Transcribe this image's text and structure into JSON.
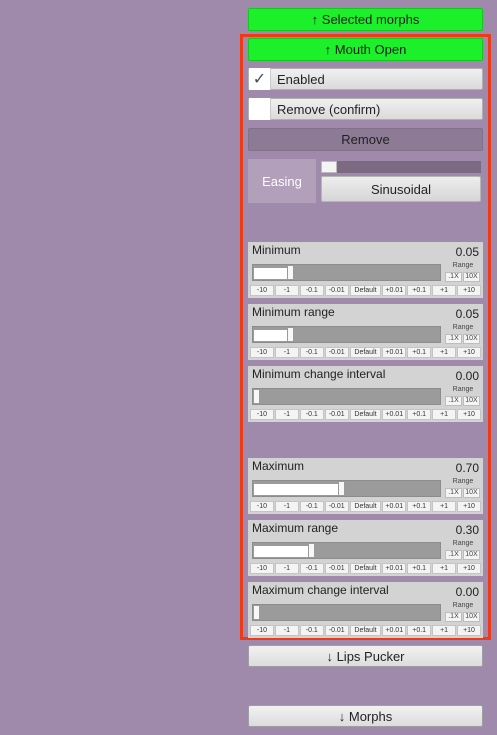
{
  "buttons": {
    "selected_morphs": "↑ Selected morphs",
    "mouth_open": "↑ Mouth Open",
    "remove": "Remove",
    "lips_pucker": "↓ Lips Pucker",
    "morphs": "↓ Morphs"
  },
  "toggles": {
    "enabled": {
      "label": "Enabled",
      "checked": true,
      "check": "✓"
    },
    "remove_confirm": {
      "label": "Remove (confirm)",
      "checked": false
    }
  },
  "easing": {
    "label": "Easing",
    "value": "Sinusoidal",
    "level": 0.0
  },
  "step_labels": [
    "-10",
    "-1",
    "-0.1",
    "-0.01",
    "Default",
    "+0.01",
    "+0.1",
    "+1",
    "+10"
  ],
  "range": {
    "label": "Range",
    "down": ".1X",
    "up": "10X"
  },
  "sliders": [
    {
      "name": "Minimum",
      "value": "0.05",
      "fraction": 0.2
    },
    {
      "name": "Minimum range",
      "value": "0.05",
      "fraction": 0.2
    },
    {
      "name": "Minimum change interval",
      "value": "0.00",
      "fraction": 0.0
    },
    {
      "name": "Maximum",
      "value": "0.70",
      "fraction": 0.47
    },
    {
      "name": "Maximum range",
      "value": "0.30",
      "fraction": 0.31
    },
    {
      "name": "Maximum change interval",
      "value": "0.00",
      "fraction": 0.0
    }
  ],
  "colors": {
    "background": "#a08aab",
    "green_button": "#1cf02a",
    "highlight_border": "#ee3a16",
    "remove_button": "#8d7a95"
  }
}
